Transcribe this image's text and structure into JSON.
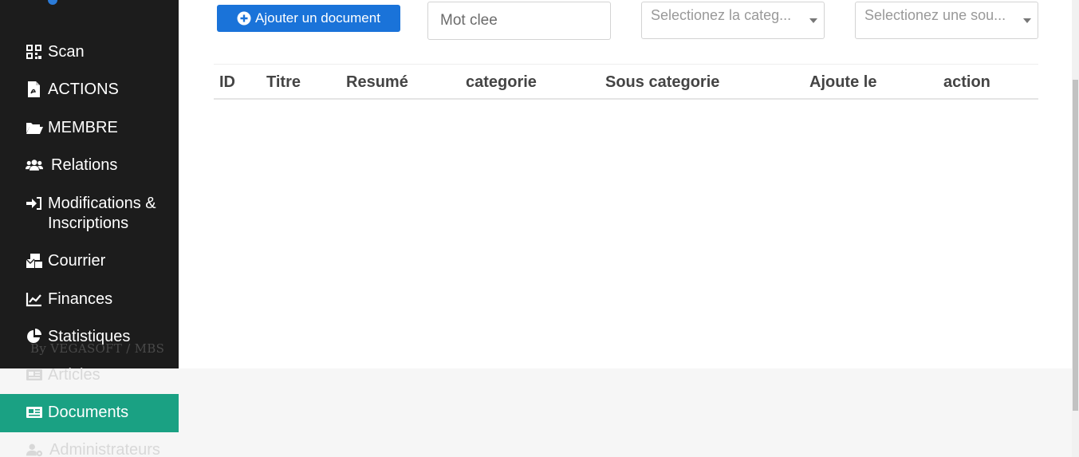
{
  "sidebar": {
    "items": [
      {
        "label": "Scan",
        "icon": "qrcode-icon"
      },
      {
        "label": "ACTIONS",
        "icon": "file-pdf-icon"
      },
      {
        "label": "MEMBRE",
        "icon": "folder-open-icon"
      },
      {
        "label": "Relations",
        "icon": "users-icon"
      },
      {
        "label": "Modifications & Inscriptions",
        "icon": "sign-in-icon"
      },
      {
        "label": "Courrier",
        "icon": "mail-bulk-icon"
      },
      {
        "label": "Finances",
        "icon": "line-chart-icon"
      },
      {
        "label": "Statistiques",
        "icon": "pie-chart-icon"
      },
      {
        "label": "Articles",
        "icon": "newspaper-icon"
      },
      {
        "label": "Documents",
        "icon": "newspaper-icon"
      },
      {
        "label": "Administrateurs",
        "icon": "users-cog-icon"
      }
    ],
    "active": "Documents",
    "credit": "By VEGASOFT / MBS"
  },
  "toolbar": {
    "add_label": "Ajouter un document",
    "search_placeholder": "Mot clee",
    "category_select": "Selectionez la categ...",
    "subcategory_select": "Selectionez une sou..."
  },
  "table": {
    "headers": [
      "ID",
      "Titre",
      "Resumé",
      "categorie",
      "Sous categorie",
      "Ajoute le",
      "action"
    ]
  },
  "colors": {
    "sidebar_bg": "#1c1c1c",
    "active_item": "#1aa183",
    "primary_button": "#1a73d9"
  }
}
